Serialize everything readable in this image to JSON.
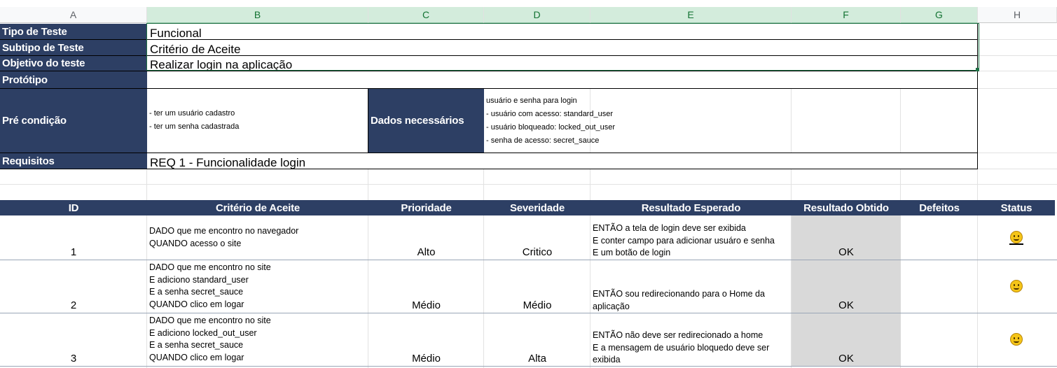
{
  "column_headers": [
    "A",
    "B",
    "C",
    "D",
    "E",
    "F",
    "G",
    "H"
  ],
  "info": {
    "tipo_label": "Tipo de Teste",
    "tipo_value": "Funcional",
    "subtipo_label": "Subtipo de Teste",
    "subtipo_value": "Critério de Aceite",
    "objetivo_label": "Objetivo do teste",
    "objetivo_value": "Realizar login na aplicação",
    "prototipo_label": "Protótipo",
    "prototipo_value": "",
    "precondicao_label": "Pré condição",
    "precondicao_lines": [
      "- ter um usuário cadastro",
      "- ter um senha cadastrada"
    ],
    "dados_label": "Dados necessários",
    "dados_lines": [
      "usuário e senha para login",
      "- usuário com acesso: standard_user",
      "- usuário bloqueado: locked_out_user",
      "- senha de acesso: secret_sauce"
    ],
    "requisitos_label": "Requisitos",
    "requisitos_value": "REQ 1 - Funcionalidade login"
  },
  "table": {
    "headers": [
      "ID",
      "Critério de Aceite",
      "Prioridade",
      "Severidade",
      "Resultado Esperado",
      "Resultado Obtido",
      "Defeitos",
      "Status"
    ],
    "rows": [
      {
        "id": "1",
        "criterio": [
          "DADO que me encontro no navegador",
          "QUANDO acesso o site"
        ],
        "prioridade": "Alto",
        "severidade": "Critico",
        "resultado_esperado": [
          "ENTÃO a tela de login deve ser exibida",
          "E conter campo para adicionar usuáro e senha",
          "E um botão de login"
        ],
        "resultado_obtido": "OK",
        "defeitos": "",
        "status_icon": "smiley-face-icon"
      },
      {
        "id": "2",
        "criterio": [
          "DADO que me encontro no site",
          "E adiciono standard_user",
          "E a senha secret_sauce",
          "QUANDO clico em logar"
        ],
        "prioridade": "Médio",
        "severidade": "Médio",
        "resultado_esperado": [
          "ENTÃO sou redirecionando para o Home da",
          "aplicação"
        ],
        "resultado_obtido": "OK",
        "defeitos": "",
        "status_icon": "smiley-face-icon"
      },
      {
        "id": "3",
        "criterio": [
          "DADO que me encontro no site",
          "E adiciono locked_out_user",
          "E a senha secret_sauce",
          "QUANDO clico em logar"
        ],
        "prioridade": "Médio",
        "severidade": "Alta",
        "resultado_esperado": [
          "ENTÃO não deve ser redirecionado a home",
          "E a mensagem de usuário bloquedo deve ser",
          "exibida"
        ],
        "resultado_obtido": "OK",
        "defeitos": "",
        "status_icon": "smiley-face-icon"
      }
    ]
  },
  "colors": {
    "header_navy": "#2d3f64",
    "selection_green": "#1e7145",
    "ok_gray": "#d9d9d9",
    "smiley_yellow": "#f5c518"
  }
}
